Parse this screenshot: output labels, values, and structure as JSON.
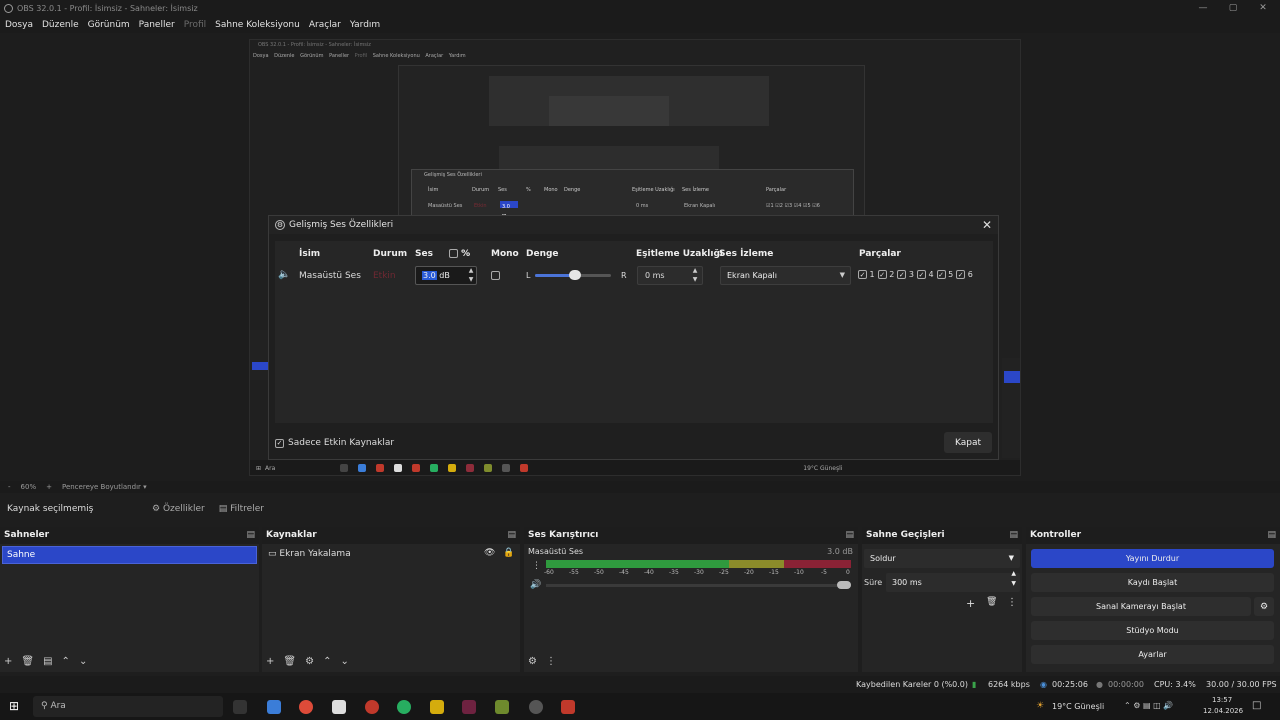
{
  "window": {
    "title": "OBS 32.0.1 - Profil: İsimsiz - Sahneler: İsimsiz"
  },
  "menu": [
    "Dosya",
    "Düzenle",
    "Görünüm",
    "Paneller",
    "Profil",
    "Sahne Koleksiyonu",
    "Araçlar",
    "Yardım"
  ],
  "nested": {
    "title": "OBS 32.0.1 - Profil: İsimsiz - Sahneler: İsimsiz",
    "menu": [
      "Dosya",
      "Düzenle",
      "Görünüm",
      "Paneller",
      "Profil",
      "Sahne Koleksiyonu",
      "Araçlar",
      "Yardım"
    ],
    "dialog_title": "Gelişmiş Ses Özellikleri",
    "headers": [
      "İsim",
      "Durum",
      "Ses",
      "%",
      "Mono",
      "Denge",
      "Eşitleme Uzaklığı",
      "Ses İzleme",
      "Parçalar"
    ],
    "row": [
      "Masaüstü Ses",
      "Etkin",
      "3.0 dB",
      "0 ms",
      "Ekran Kapalı",
      "☑1 ☑2 ☑3 ☑4 ☑5 ☑6"
    ],
    "taskbar_search": "Ara",
    "weather": "19°C Güneşli"
  },
  "dialog": {
    "title": "Gelişmiş Ses Özellikleri",
    "headers": {
      "name": "İsim",
      "status": "Durum",
      "volume": "Ses",
      "percent": "%",
      "mono": "Mono",
      "balance": "Denge",
      "sync": "Eşitleme Uzaklığı",
      "monitoring": "Ses İzleme",
      "tracks": "Parçalar"
    },
    "row": {
      "name": "Masaüstü Ses",
      "status": "Etkin",
      "volume_sel": "3.0",
      "volume_unit": " dB",
      "bal_l": "L",
      "bal_r": "R",
      "sync": "0 ms",
      "monitoring": "Ekran Kapalı"
    },
    "tracks": [
      "1",
      "2",
      "3",
      "4",
      "5",
      "6"
    ],
    "only_active": "Sadece Etkin Kaynaklar",
    "close_label": "Kapat"
  },
  "zoom": {
    "minus": "-",
    "level": "60%",
    "plus": "+",
    "fit": "Pencereye Boyutlandır"
  },
  "source_bar": {
    "label": "Kaynak seçilmemiş",
    "properties": "Özellikler",
    "filters": "Filtreler"
  },
  "scenes": {
    "title": "Sahneler",
    "items": [
      "Sahne"
    ]
  },
  "sources": {
    "title": "Kaynaklar",
    "items": [
      "Ekran Yakalama"
    ]
  },
  "mixer": {
    "title": "Ses Karıştırıcı",
    "channel": "Masaüstü Ses",
    "db": "3.0 dB",
    "ticks": [
      "-60",
      "-55",
      "-50",
      "-45",
      "-40",
      "-35",
      "-30",
      "-25",
      "-20",
      "-15",
      "-10",
      "-5",
      "0"
    ]
  },
  "transitions": {
    "title": "Sahne Geçişleri",
    "type": "Soldur",
    "duration_label": "Süre",
    "duration": "300 ms"
  },
  "controls": {
    "title": "Kontroller",
    "stop_stream": "Yayını Durdur",
    "start_record": "Kaydı Başlat",
    "virtual_cam": "Sanal Kamerayı Başlat",
    "studio": "Stüdyo Modu",
    "settings": "Ayarlar"
  },
  "status": {
    "dropped": "Kaybedilen Kareler 0 (%0.0)",
    "bitrate": "6264 kbps",
    "stream_time": "00:25:06",
    "rec_time": "00:00:00",
    "cpu": "CPU: 3.4%",
    "fps": "30.00 / 30.00 FPS"
  },
  "taskbar": {
    "search": "Ara",
    "weather": "19°C Güneşli",
    "time": "13:57",
    "date": "12.04.2026"
  },
  "colors": {
    "accent": "#2b47c8",
    "meter_green": "#2f9a3e",
    "meter_yellow": "#8b8b2a",
    "meter_red": "#8a2235"
  }
}
